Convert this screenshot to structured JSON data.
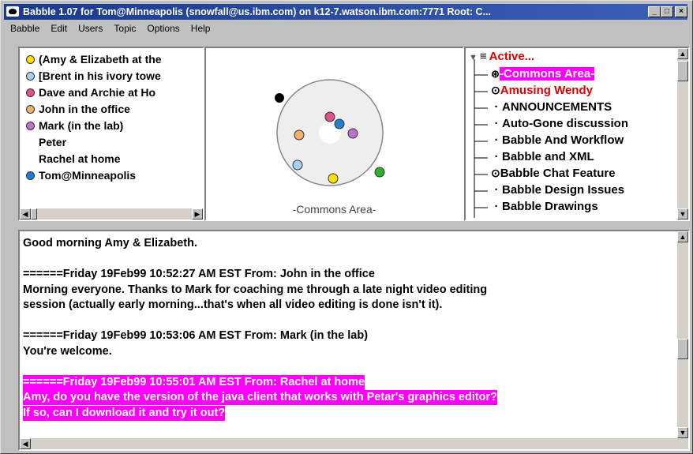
{
  "window": {
    "title": "Babble 1.07 for Tom@Minneapolis (snowfall@us.ibm.com)  on k12-7.watson.ibm.com:7771  Root: C..."
  },
  "menu": [
    "Babble",
    "Edit",
    "Users",
    "Topic",
    "Options",
    "Help"
  ],
  "users": [
    {
      "name": "(Amy & Elizabeth at the",
      "color": "#ffe000"
    },
    {
      "name": "[Brent in his ivory towe",
      "color": "#a8d0f0"
    },
    {
      "name": "Dave and Archie at Ho",
      "color": "#e0508a"
    },
    {
      "name": "John in the office",
      "color": "#f0b070"
    },
    {
      "name": "Mark (in the lab)",
      "color": "#c070d0"
    },
    {
      "name": "Peter",
      "color": ""
    },
    {
      "name": "Rachel at home",
      "color": ""
    },
    {
      "name": "Tom@Minneapolis",
      "color": "#2080d0"
    }
  ],
  "graph": {
    "caption": "-Commons Area-"
  },
  "topics": {
    "root": "Active...",
    "items": [
      {
        "label": "-Commons Area-",
        "style": "selected"
      },
      {
        "label": "Amusing Wendy",
        "style": "red"
      },
      {
        "label": "ANNOUNCEMENTS",
        "style": "normal"
      },
      {
        "label": "Auto-Gone discussion",
        "style": "normal"
      },
      {
        "label": "Babble And Workflow",
        "style": "normal"
      },
      {
        "label": "Babble and XML",
        "style": "normal"
      },
      {
        "label": "Babble Chat Feature",
        "style": "normal"
      },
      {
        "label": "Babble Design Issues",
        "style": "normal"
      },
      {
        "label": "Babble Drawings",
        "style": "normal"
      }
    ]
  },
  "chat": [
    "Good morning Amy & Elizabeth.",
    "",
    "======Friday 19Feb99 10:52:27 AM EST    From: John in the office",
    "Morning everyone.  Thanks to Mark for coaching me through a late night video editing",
    "session (actually early morning...that's when all video editing is done isn't it).",
    "",
    "======Friday 19Feb99 10:53:06 AM EST    From: Mark (in the lab)",
    "You're welcome.",
    "",
    "======Friday 19Feb99 10:55:01 AM EST    From: Rachel at home",
    "Amy, do you have the version of the java client that works with Petar's graphics editor?",
    "If so, can I download it and try it out?"
  ],
  "colors": {
    "highlight": "#ff00ff",
    "red_topic": "#e00000",
    "title_bar": "#1b3a8c"
  }
}
